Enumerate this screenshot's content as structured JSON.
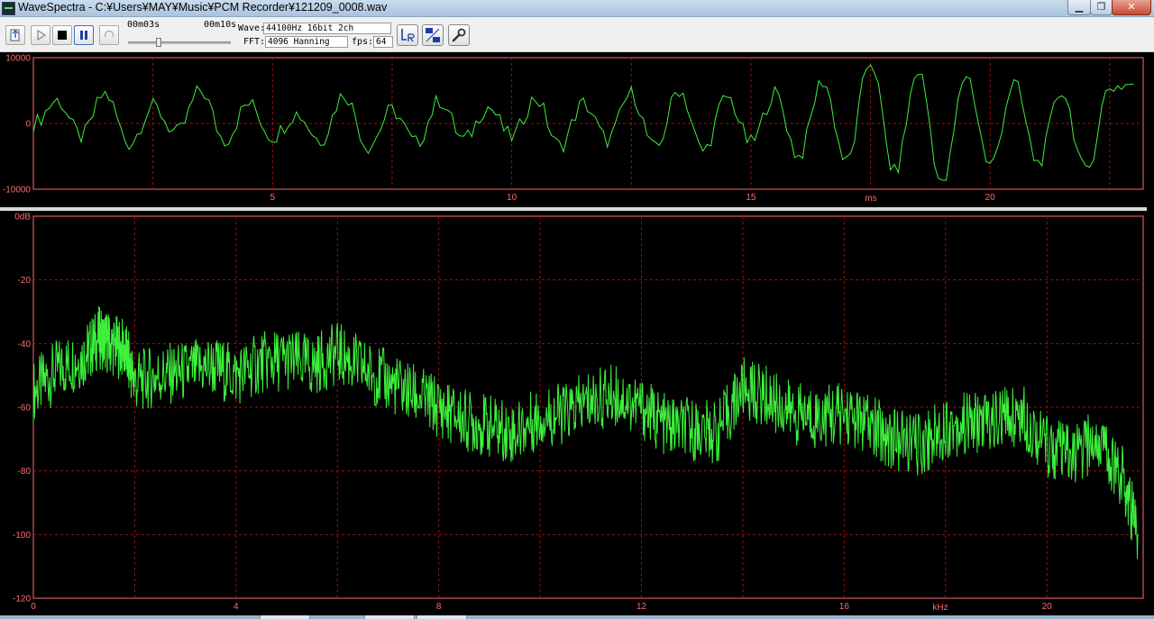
{
  "window": {
    "title": "WaveSpectra - C:¥Users¥MAY¥Music¥PCM Recorder¥121209_0008.wav",
    "min_glyph": "▁",
    "max_glyph": "❐",
    "close_glyph": "✕"
  },
  "toolbar": {
    "position_time": "00m03s",
    "total_time": "00m10s",
    "position_fraction": 0.3,
    "wave_label": "Wave:",
    "wave_value": "44100Hz 16bit 2ch",
    "fft_label": "FFT:",
    "fft_value": "4096 Hanning",
    "fps_label": "fps:",
    "fps_value": "64",
    "buttons": [
      "open-icon",
      "play-icon",
      "stop-icon",
      "pause-icon",
      "loop-icon",
      "channel-lr-icon",
      "hz-db-icon",
      "settings-icon"
    ]
  },
  "chart_data": [
    {
      "type": "line",
      "series_color": "#3cf03c",
      "grid": true,
      "grid_color": "#a01010",
      "axis_color": "#ff6a6a",
      "xlabel": "ms",
      "x_ticks": [
        5,
        10,
        15,
        20
      ],
      "xlim": [
        0,
        23.2
      ],
      "y_tick_labels": [
        "10000",
        "0",
        "-10000"
      ],
      "y_ticks": [
        10000,
        0,
        -10000
      ],
      "ylim": [
        -10000,
        10000
      ],
      "description_of_signal": "",
      "series": [
        {
          "x": [
            0,
            0.5,
            1,
            1.5,
            2,
            2.5,
            3,
            3.5,
            4,
            4.5,
            5,
            5.5,
            6,
            6.5,
            7,
            7.5,
            8,
            8.5,
            9,
            9.5,
            10,
            10.5,
            11,
            11.5,
            12,
            12.5,
            13,
            13.5,
            14,
            14.5,
            15,
            15.5,
            16,
            16.5,
            17,
            17.5,
            18,
            18.5,
            19,
            19.5,
            20,
            20.5,
            21,
            21.5,
            22,
            22.5,
            23
          ],
          "y": [
            0,
            3500,
            -2000,
            4500,
            -3000,
            2500,
            -1500,
            5000,
            -2500,
            3000,
            -2000,
            1500,
            -2500,
            4500,
            -3500,
            2000,
            -3000,
            3500,
            -2500,
            2500,
            -2000,
            3800,
            -3500,
            3000,
            -2500,
            4500,
            -4000,
            5200,
            -4200,
            4000,
            -3000,
            4500,
            -5000,
            6500,
            -6000,
            9500,
            -7500,
            8000,
            -9500,
            7500,
            -6500,
            6000,
            -6000,
            5000,
            -7500,
            5500,
            6000
          ]
        }
      ]
    },
    {
      "type": "line",
      "series_color": "#3cf03c",
      "grid": true,
      "grid_color": "#a01010",
      "axis_color": "#ff6a6a",
      "xlabel": "kHz",
      "x_ticks": [
        0,
        4,
        8,
        12,
        16,
        20
      ],
      "xlim": [
        0,
        21.9
      ],
      "y_tick_labels": [
        "0dB",
        "-20",
        "-40",
        "-60",
        "-80",
        "-100",
        "-120"
      ],
      "y_ticks": [
        0,
        -20,
        -40,
        -60,
        -80,
        -100,
        -120
      ],
      "ylim": [
        -120,
        0
      ],
      "series": [
        {
          "x": [
            0,
            0.5,
            1,
            1.3,
            1.5,
            1.8,
            2,
            2.5,
            3,
            3.5,
            4,
            4.5,
            5,
            5.5,
            6,
            6.5,
            7,
            7.5,
            8,
            8.5,
            9,
            9.5,
            10,
            10.5,
            11,
            11.5,
            12,
            12.5,
            13,
            13.5,
            14,
            14.5,
            15,
            15.5,
            16,
            16.5,
            17,
            17.5,
            18,
            18.5,
            19,
            19.5,
            20,
            20.5,
            21,
            21.5,
            21.8
          ],
          "y": [
            -55,
            -48,
            -44,
            -38,
            -40,
            -42,
            -52,
            -50,
            -49,
            -47,
            -50,
            -46,
            -45,
            -47,
            -43,
            -48,
            -52,
            -56,
            -60,
            -64,
            -66,
            -68,
            -63,
            -62,
            -58,
            -56,
            -60,
            -66,
            -67,
            -68,
            -54,
            -57,
            -62,
            -63,
            -62,
            -66,
            -70,
            -72,
            -66,
            -65,
            -64,
            -62,
            -72,
            -76,
            -70,
            -82,
            -100
          ]
        }
      ]
    }
  ]
}
